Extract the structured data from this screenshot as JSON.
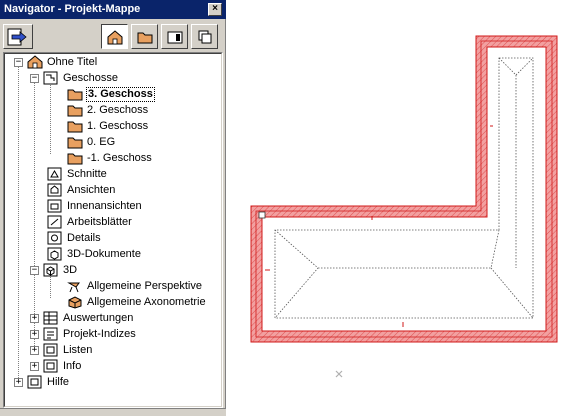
{
  "window": {
    "title": "Navigator - Projekt-Mappe",
    "close_glyph": "×"
  },
  "toolbar": {
    "buttons": [
      {
        "name": "project-map",
        "icon": "house-icon"
      },
      {
        "name": "view-map",
        "icon": "folder-icon"
      },
      {
        "name": "layout-book",
        "icon": "layout-icon"
      },
      {
        "name": "publisher",
        "icon": "copies-icon"
      }
    ]
  },
  "tree": {
    "root": "Ohne Titel",
    "geschosse": "Geschosse",
    "stories": [
      "3. Geschoss",
      "2. Geschoss",
      "1. Geschoss",
      "0. EG",
      "-1. Geschoss"
    ],
    "selected_story": "3. Geschoss",
    "schnitte": "Schnitte",
    "ansichten": "Ansichten",
    "innenansichten": "Innenansichten",
    "arbeitsblaetter": "Arbeitsblätter",
    "details": "Details",
    "dokumente3d": "3D-Dokumente",
    "d3": "3D",
    "perspektive": "Allgemeine Perspektive",
    "axonometrie": "Allgemeine Axonometrie",
    "auswertungen": "Auswertungen",
    "indizes": "Projekt-Indizes",
    "listen": "Listen",
    "info": "Info",
    "hilfe": "Hilfe",
    "expand_glyph": "+",
    "collapse_glyph": "−"
  },
  "colors": {
    "titlebar": "#0a246a",
    "wall_fill": "#f2a0a0",
    "wall_stroke": "#d01818",
    "folder": "#e8a060"
  }
}
